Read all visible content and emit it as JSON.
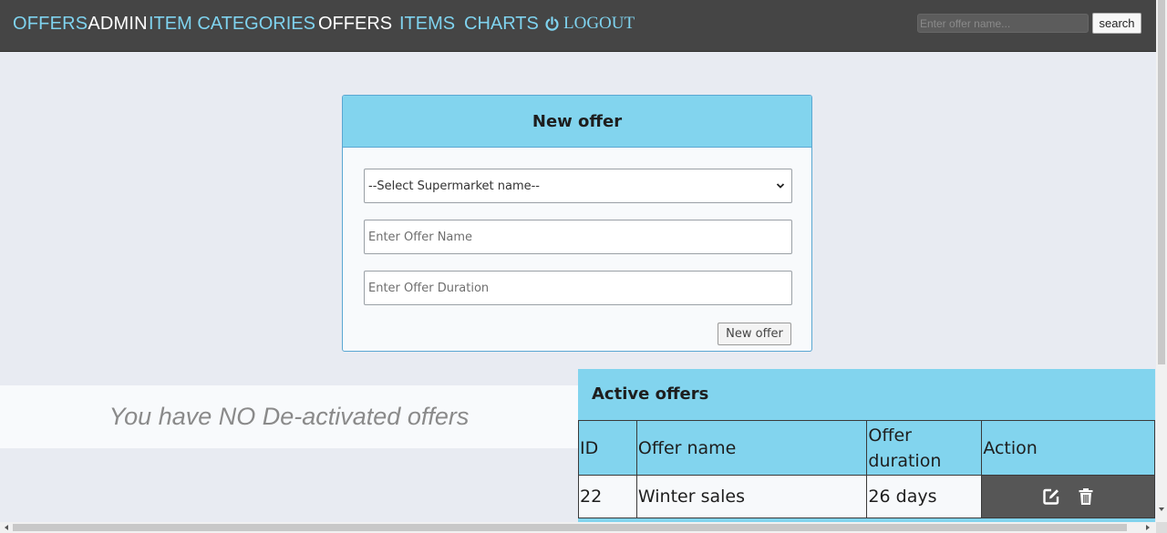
{
  "nav": {
    "brand_part1": "OFFERS",
    "brand_part2": "ADMIN",
    "links": [
      {
        "label": "ITEM CATEGORIES"
      },
      {
        "label": "OFFERS"
      },
      {
        "label": "ITEMS"
      },
      {
        "label": "CHARTS"
      }
    ],
    "logout_label": "LOGOUT",
    "search_placeholder": "Enter offer name...",
    "search_button": "search"
  },
  "new_offer": {
    "title": "New offer",
    "supermarket_select": "--Select Supermarket name--",
    "offer_name_placeholder": "Enter Offer Name",
    "offer_duration_placeholder": "Enter Offer Duration",
    "submit_label": "New offer"
  },
  "deactivated": {
    "message": "You have NO De-activated offers"
  },
  "active_offers": {
    "title": "Active offers",
    "columns": [
      "ID",
      "Offer name",
      "Offer duration",
      "Action"
    ],
    "rows": [
      {
        "id": "22",
        "name": "Winter sales",
        "duration": "26 days"
      }
    ]
  },
  "colors": {
    "navbar": "#454545",
    "accent": "#7fd3ef",
    "panel_header": "#82d4ee",
    "page_bg": "#e8ebf2"
  }
}
